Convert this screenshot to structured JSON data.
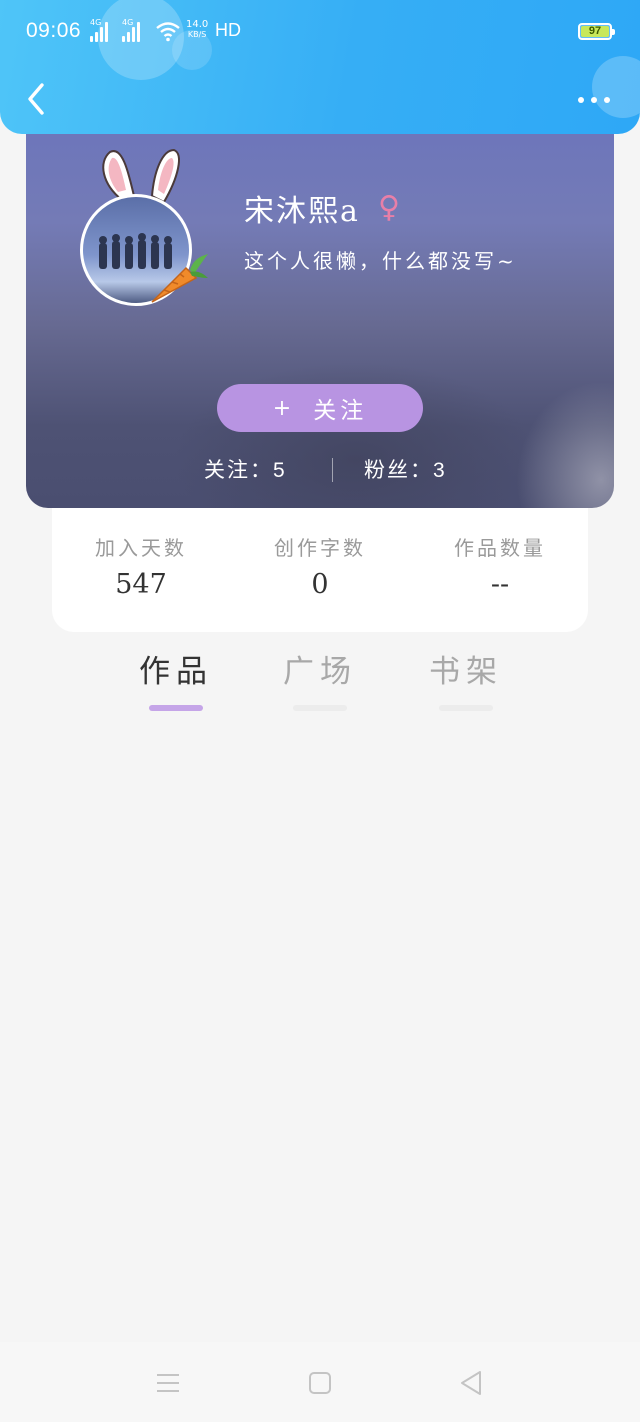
{
  "status_bar": {
    "time": "09:06",
    "network_1": "4G",
    "network_2": "4G",
    "speed_value": "14.0",
    "speed_unit": "KB/S",
    "hd": "HD",
    "battery": "97"
  },
  "nav": {
    "back_icon": "chevron-left-icon",
    "more_icon": "more-dots-icon"
  },
  "profile": {
    "username": "宋沐熙a",
    "gender_symbol": "♀",
    "bio": "这个人很懒，什么都没写~",
    "follow_label": "关注",
    "follow_plus": "+",
    "following_label": "关注",
    "following_count": "5",
    "fans_label": "粉丝",
    "fans_count": "3",
    "separator": "："
  },
  "stats": [
    {
      "label": "加入天数",
      "value": "547"
    },
    {
      "label": "创作字数",
      "value": "0"
    },
    {
      "label": "作品数量",
      "value": "--"
    }
  ],
  "tabs": [
    {
      "label": "作品",
      "active": true
    },
    {
      "label": "广场",
      "active": false
    },
    {
      "label": "书架",
      "active": false
    }
  ],
  "colors": {
    "header": "#36aef5",
    "accent_purple": "#b894e2",
    "tab_underline": "#c5a5e8",
    "gender_pink": "#e87fa8",
    "battery_green": "#c8e85a"
  }
}
